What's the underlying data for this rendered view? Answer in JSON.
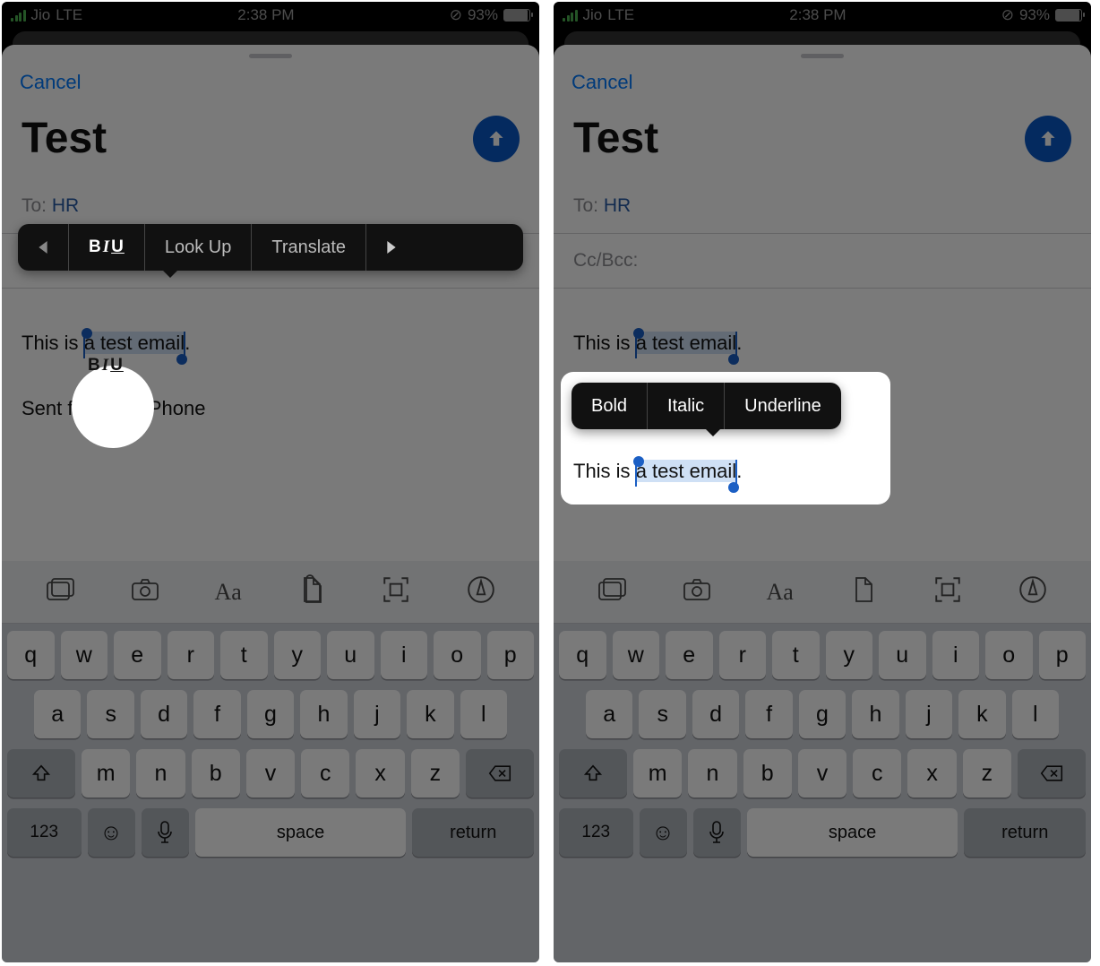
{
  "status": {
    "carrier": "Jio",
    "network": "LTE",
    "time": "2:38 PM",
    "battery_pct": "93%"
  },
  "compose": {
    "cancel": "Cancel",
    "subject": "Test",
    "to_label": "To:",
    "to_value": "HR",
    "cc_label": "Cc/Bcc:",
    "body_pre": "This is ",
    "body_sel": "a test email",
    "body_post": ".",
    "signature": "Sent from my iPhone"
  },
  "ctx1": {
    "biu_label": "BIU",
    "lookup": "Look Up",
    "translate": "Translate"
  },
  "ctx2": {
    "bold": "Bold",
    "italic": "Italic",
    "underline": "Underline"
  },
  "keyboard": {
    "row1": [
      "q",
      "w",
      "e",
      "r",
      "t",
      "y",
      "u",
      "i",
      "o",
      "p"
    ],
    "row2": [
      "a",
      "s",
      "d",
      "f",
      "g",
      "h",
      "j",
      "k",
      "l"
    ],
    "row3": [
      "z",
      "x",
      "c",
      "v",
      "b",
      "n",
      "m"
    ],
    "abc": "123",
    "space": "space",
    "return": "return"
  }
}
